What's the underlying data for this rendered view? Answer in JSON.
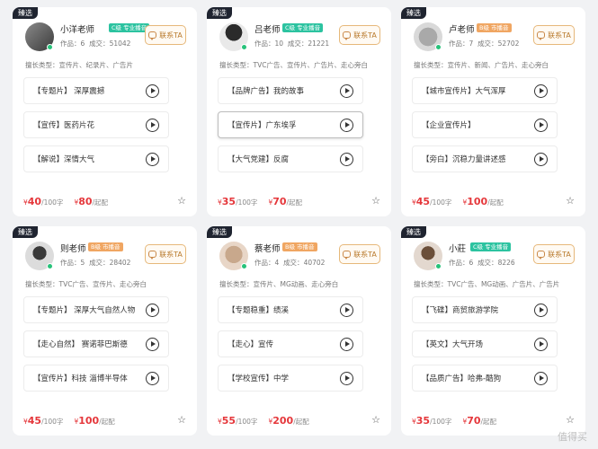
{
  "labels": {
    "select_tag": "臻选",
    "contact": "联系TA",
    "works_prefix": "作品：",
    "deals_prefix": "成交：",
    "specialty_prefix": "擅长类型：",
    "price_unit_word": "/100字",
    "price_unit_start": "/起配",
    "currency": "¥"
  },
  "cards": [
    {
      "name": "小洋老师",
      "level": "C级 专业播音",
      "level_class": "c",
      "works": "6",
      "deals": "51042",
      "specialty": "宣传片、纪录片、广告片",
      "items": [
        "【专题片】 深厚震撼",
        "【宣传】医药片花",
        "【解说】深情大气"
      ],
      "price_word": "40",
      "price_start": "80"
    },
    {
      "name": "吕老师",
      "level": "C级 专业播音",
      "level_class": "c",
      "works": "10",
      "deals": "21221",
      "specialty": "TVC广告、宣传片、广告片、走心旁白",
      "items": [
        "【品牌广告】我的故事",
        "【宣传片】广东埃孚",
        "【大气党建】反腐"
      ],
      "price_word": "35",
      "price_start": "70"
    },
    {
      "name": "卢老师",
      "level": "B级 市播音",
      "level_class": "b",
      "works": "7",
      "deals": "52702",
      "specialty": "宣传片、新闻、广告片、走心旁白",
      "items": [
        "【城市宣传片】大气浑厚",
        "【企业宣传片】",
        "【旁白】沉稳力量讲述感"
      ],
      "price_word": "45",
      "price_start": "100"
    },
    {
      "name": "则老师",
      "level": "B级 市播音",
      "level_class": "b",
      "works": "5",
      "deals": "28402",
      "specialty": "TVC广告、宣传片、走心旁白",
      "items": [
        "【专题片】 深厚大气自然人物",
        "【走心自然】 赛诺菲巴斯德",
        "【宣传片】科技 淄博半导体"
      ],
      "price_word": "45",
      "price_start": "100"
    },
    {
      "name": "蔡老师",
      "level": "B级 市播音",
      "level_class": "b",
      "works": "4",
      "deals": "40702",
      "specialty": "宣传片、MG动画、走心旁白",
      "items": [
        "【专题稳重】绩溪",
        "【走心】宣传",
        "【学校宣传】中学"
      ],
      "price_word": "55",
      "price_start": "200"
    },
    {
      "name": "小莊",
      "level": "C级 专业播音",
      "level_class": "c",
      "works": "6",
      "deals": "8226",
      "specialty": "TVC广告、MG动画、广告片、广告片",
      "items": [
        "【飞碟】商贸旅游学院",
        "【英文】大气开场",
        "【品质广告】哈弗-酷狗"
      ],
      "price_word": "35",
      "price_start": "70"
    }
  ],
  "watermark": "值得买"
}
